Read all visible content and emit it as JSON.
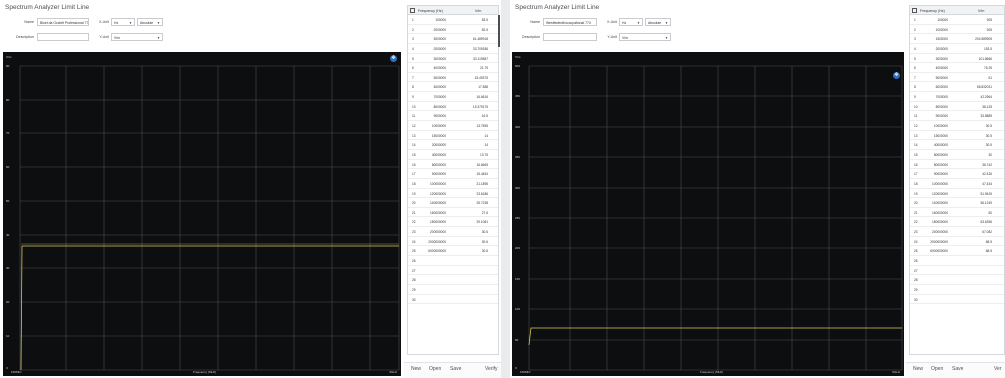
{
  "left": {
    "title": "Spectrum Analyzer Limit Line",
    "form": {
      "name_label": "Name",
      "name_value": "Bluet da Occtelt Professional 774",
      "description_label": "Description",
      "description_value": "",
      "xunit_label": "X-Unit",
      "xunit_value": "Hz",
      "xmode_value": "Absolute",
      "yunit_label": "Y-Unit",
      "yunit_value": "V/m"
    },
    "plot": {
      "unit": "V/m",
      "y_ticks": [
        "90",
        "80",
        "70",
        "60",
        "50",
        "40",
        "30",
        "20",
        "10",
        "0"
      ],
      "x_start": "150Mhz",
      "x_label": "Frequency (MHz)",
      "x_end": "6GHz"
    },
    "table": {
      "headers": [
        "Frequency (Hz)",
        "V/m"
      ],
      "rows": [
        [
          "1",
          "100000",
          "83.5"
        ],
        [
          "2",
          "2000000",
          "82.5"
        ],
        [
          "3",
          "5000000",
          "61.489918"
        ],
        [
          "4",
          "2000000",
          "33.709186"
        ],
        [
          "5",
          "3000000",
          "33.119587"
        ],
        [
          "6",
          "4000000",
          "21.75"
        ],
        [
          "7",
          "5000000",
          "15.49375"
        ],
        [
          "8",
          "6000000",
          "17.588"
        ],
        [
          "9",
          "7000000",
          "16.6616"
        ],
        [
          "10",
          "8000000",
          "15.379175"
        ],
        [
          "11",
          "9000000",
          "16.5"
        ],
        [
          "12",
          "10000000",
          "13.7555"
        ],
        [
          "13",
          "15000000",
          "14"
        ],
        [
          "14",
          "20000000",
          "14"
        ],
        [
          "15",
          "40000000",
          "13.75"
        ],
        [
          "16",
          "80000000",
          "16.6665"
        ],
        [
          "17",
          "90000000",
          "15.4454"
        ],
        [
          "18",
          "100000000",
          "21.1896"
        ],
        [
          "19",
          "120000000",
          "23.6186"
        ],
        [
          "20",
          "140000000",
          "25.7238"
        ],
        [
          "21",
          "160000000",
          "27.6"
        ],
        [
          "22",
          "180000000",
          "29.1081"
        ],
        [
          "23",
          "200000000",
          "30.6"
        ],
        [
          "24",
          "2000000000",
          "30.6"
        ],
        [
          "25",
          "6000000000",
          "30.6"
        ],
        [
          "26",
          "",
          ""
        ],
        [
          "27",
          "",
          ""
        ],
        [
          "28",
          "",
          ""
        ],
        [
          "29",
          "",
          ""
        ],
        [
          "30",
          "",
          ""
        ]
      ]
    },
    "buttons": {
      "new": "New",
      "open": "Open",
      "save": "Save",
      "verify": "Verify"
    }
  },
  "right": {
    "title": "Spectrum Analyzer Limit Line",
    "form": {
      "name_label": "Name",
      "name_value": "Westfederdt/occupational 774",
      "description_label": "Description",
      "description_value": "",
      "xunit_label": "X-Unit",
      "xunit_value": "Hz",
      "xmode_value": "Absolute",
      "yunit_label": "Y-Unit",
      "yunit_value": "V/m"
    },
    "plot": {
      "unit": "V/m",
      "y_ticks": [
        "500",
        "450",
        "400",
        "350",
        "300",
        "250",
        "200",
        "150",
        "100",
        "50",
        "0"
      ],
      "x_start": "150Mhz",
      "x_label": "Frequency (MHz)",
      "x_end": "6GHz"
    },
    "table": {
      "headers": [
        "Frequency (Hz)",
        "V/m"
      ],
      "rows": [
        [
          "1",
          "100000",
          "305"
        ],
        [
          "2",
          "1000000",
          "305"
        ],
        [
          "3",
          "1500000",
          "204.589905"
        ],
        [
          "4",
          "2000000",
          "153.5"
        ],
        [
          "5",
          "3000000",
          "101.8666"
        ],
        [
          "6",
          "4000000",
          "76.25"
        ],
        [
          "7",
          "5000000",
          "61"
        ],
        [
          "8",
          "6000000",
          "56.832031"
        ],
        [
          "9",
          "7000000",
          "42.2964"
        ],
        [
          "10",
          "8000000",
          "38.125"
        ],
        [
          "11",
          "9000000",
          "33.8889"
        ],
        [
          "12",
          "10000000",
          "30.5"
        ],
        [
          "13",
          "15000000",
          "30.5"
        ],
        [
          "14",
          "40000000",
          "30.5"
        ],
        [
          "15",
          "80000000",
          "30"
        ],
        [
          "16",
          "80000000",
          "36.742"
        ],
        [
          "17",
          "90000000",
          "42.426"
        ],
        [
          "18",
          "100000000",
          "47.434"
        ],
        [
          "19",
          "120000000",
          "51.9615"
        ],
        [
          "20",
          "140000000",
          "56.1249"
        ],
        [
          "21",
          "160000000",
          "60"
        ],
        [
          "22",
          "180000000",
          "63.6396"
        ],
        [
          "23",
          "200000000",
          "67.082"
        ],
        [
          "24",
          "2000000000",
          "68.5"
        ],
        [
          "25",
          "6000000000",
          "68.5"
        ],
        [
          "26",
          "",
          ""
        ],
        [
          "27",
          "",
          ""
        ],
        [
          "28",
          "",
          ""
        ],
        [
          "29",
          "",
          ""
        ],
        [
          "30",
          "",
          ""
        ]
      ]
    },
    "buttons": {
      "new": "New",
      "open": "Open",
      "save": "Save",
      "verify": "Ver"
    }
  }
}
